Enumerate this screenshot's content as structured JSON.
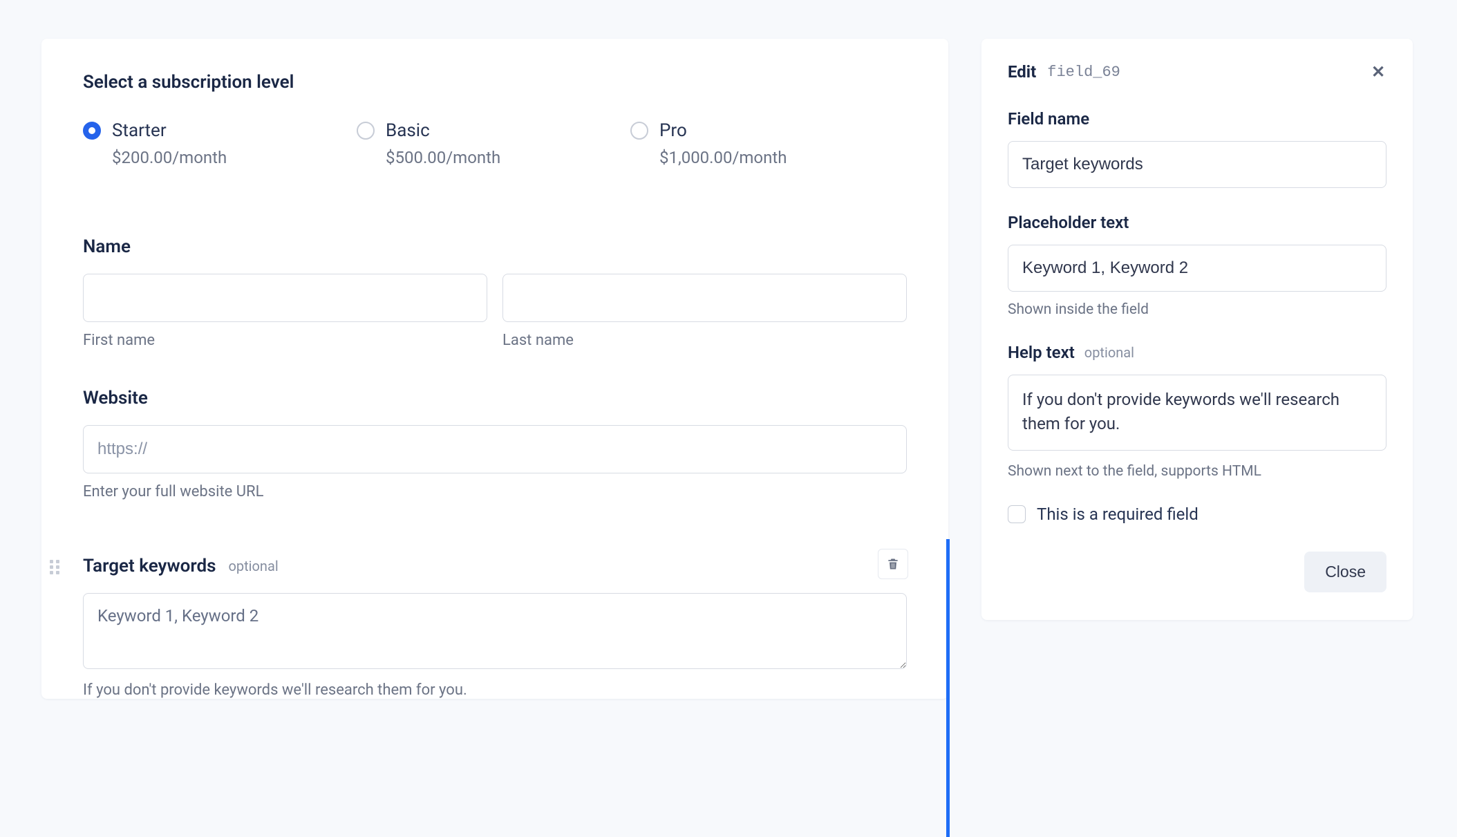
{
  "main": {
    "subscription_title": "Select a subscription level",
    "plans": [
      {
        "name": "Starter",
        "price": "$200.00/month",
        "selected": true
      },
      {
        "name": "Basic",
        "price": "$500.00/month",
        "selected": false
      },
      {
        "name": "Pro",
        "price": "$1,000.00/month",
        "selected": false
      }
    ],
    "name_label": "Name",
    "first_name_sublabel": "First name",
    "last_name_sublabel": "Last name",
    "website_label": "Website",
    "website_placeholder": "https://",
    "website_help": "Enter your full website URL",
    "keywords_label": "Target keywords",
    "keywords_optional": "optional",
    "keywords_placeholder": "Keyword 1, Keyword 2",
    "keywords_help": "If you don't provide keywords we'll research them for you."
  },
  "panel": {
    "edit_label": "Edit",
    "field_id": "field_69",
    "field_name_label": "Field name",
    "field_name_value": "Target keywords",
    "placeholder_label": "Placeholder text",
    "placeholder_value": "Keyword 1, Keyword 2",
    "placeholder_help": "Shown inside the field",
    "help_label": "Help text",
    "help_optional": "optional",
    "help_value": "If you don't provide keywords we'll research them for you.",
    "help_help": "Shown next to the field, supports HTML",
    "required_label": "This is a required field",
    "close_button": "Close"
  }
}
